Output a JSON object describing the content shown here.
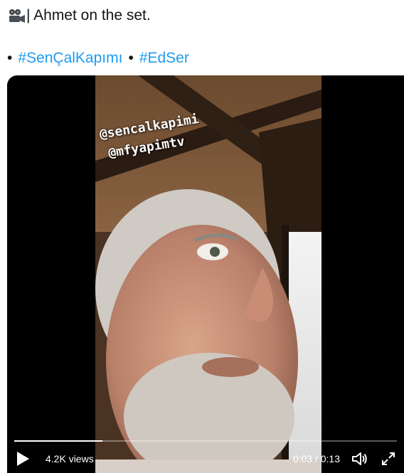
{
  "tweet": {
    "icon": "movie-camera-icon",
    "text": "| Ahmet on the set.",
    "hashtags": [
      "#SenÇalKapımı",
      "#EdSer"
    ],
    "bullet": "•"
  },
  "video": {
    "stickers": [
      "@sencalkapimi",
      "@mfyapimtv"
    ],
    "views": "4.2K views",
    "current_time": "0:03",
    "time_separator": "/",
    "duration": "0:13",
    "progress": 0.23,
    "icons": {
      "play": "play-icon",
      "volume": "volume-icon",
      "fullscreen": "fullscreen-icon"
    },
    "colors": {
      "link": "#1d9bf0",
      "background": "#000000"
    }
  }
}
